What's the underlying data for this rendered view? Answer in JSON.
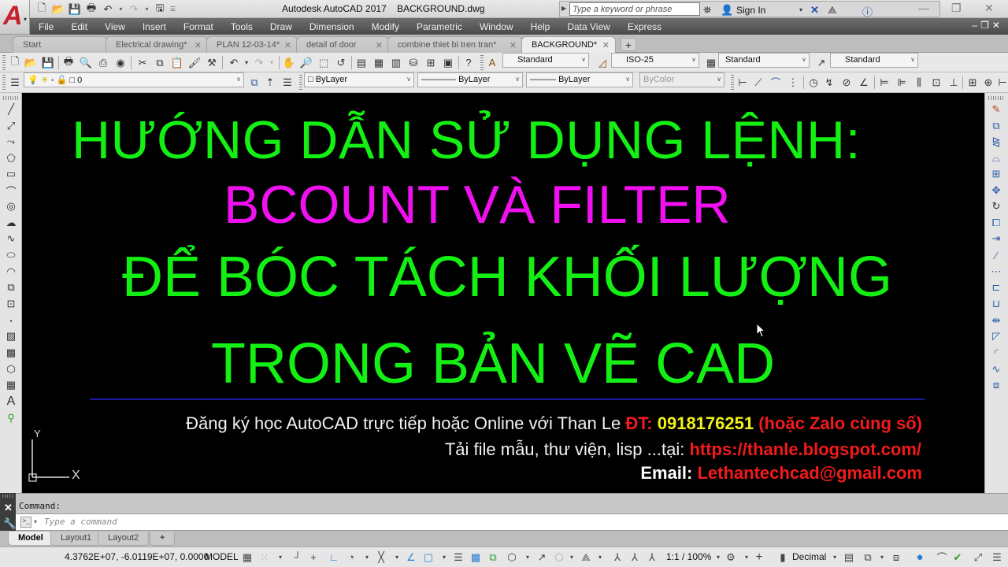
{
  "window": {
    "title": "Autodesk AutoCAD 2017    BACKGROUND.dwg",
    "search_placeholder": "Type a keyword or phrase",
    "sign_in": "Sign In"
  },
  "menu": [
    "File",
    "Edit",
    "View",
    "Insert",
    "Format",
    "Tools",
    "Draw",
    "Dimension",
    "Modify",
    "Parametric",
    "Window",
    "Help",
    "Data View",
    "Express"
  ],
  "doc_tabs": [
    {
      "label": "Start",
      "closable": false,
      "active": false
    },
    {
      "label": "Electrical drawing*",
      "closable": true,
      "active": false
    },
    {
      "label": "PLAN 12-03-14*",
      "closable": true,
      "active": false
    },
    {
      "label": "detail of door",
      "closable": true,
      "active": false
    },
    {
      "label": "combine thiet bi tren tran*",
      "closable": true,
      "active": false
    },
    {
      "label": "BACKGROUND*",
      "closable": true,
      "active": true
    }
  ],
  "toolbar_styles": {
    "text_style": "Standard",
    "dim_style": "ISO-25",
    "table_style": "Standard",
    "multileader_style": "Standard"
  },
  "toolbar_layers": {
    "current_layer": "0",
    "color": "ByLayer",
    "linetype": "ByLayer",
    "lineweight": "ByLayer",
    "plot_style": "ByColor"
  },
  "drawing": {
    "heading1": "HƯỚNG DẪN SỬ DỤNG LỆNH:",
    "heading2": "BCOUNT VÀ FILTER",
    "heading3": "ĐỂ BÓC TÁCH KHỐI LƯỢNG",
    "heading4": "TRONG BẢN VẼ CAD",
    "info1_text": "Đăng ký học AutoCAD trực tiếp hoặc Online với Than Le ",
    "info1_phone_label": "ĐT: ",
    "info1_phone": "0918176251",
    "info1_note": " (hoặc Zalo cùng số)",
    "info2_text": "Tải file mẫu, thư viện, lisp ...tại:  ",
    "info2_link": "https://thanle.blogspot.com/",
    "info3_label": "Email: ",
    "info3_email": "Lethantechcad@gmail.com",
    "ucs_x": "X",
    "ucs_y": "Y",
    "colors": {
      "green": "#14f014",
      "magenta": "#f010f0",
      "red": "#f21a1a",
      "yellow": "#f2f21a"
    }
  },
  "command": {
    "label": "Command:",
    "placeholder": "Type a command"
  },
  "layout_tabs": [
    "Model",
    "Layout1",
    "Layout2"
  ],
  "status": {
    "coords": "4.3762E+07, -6.0119E+07, 0.0000",
    "space": "MODEL",
    "scale": "1:1 / 100%",
    "units": "Decimal"
  }
}
